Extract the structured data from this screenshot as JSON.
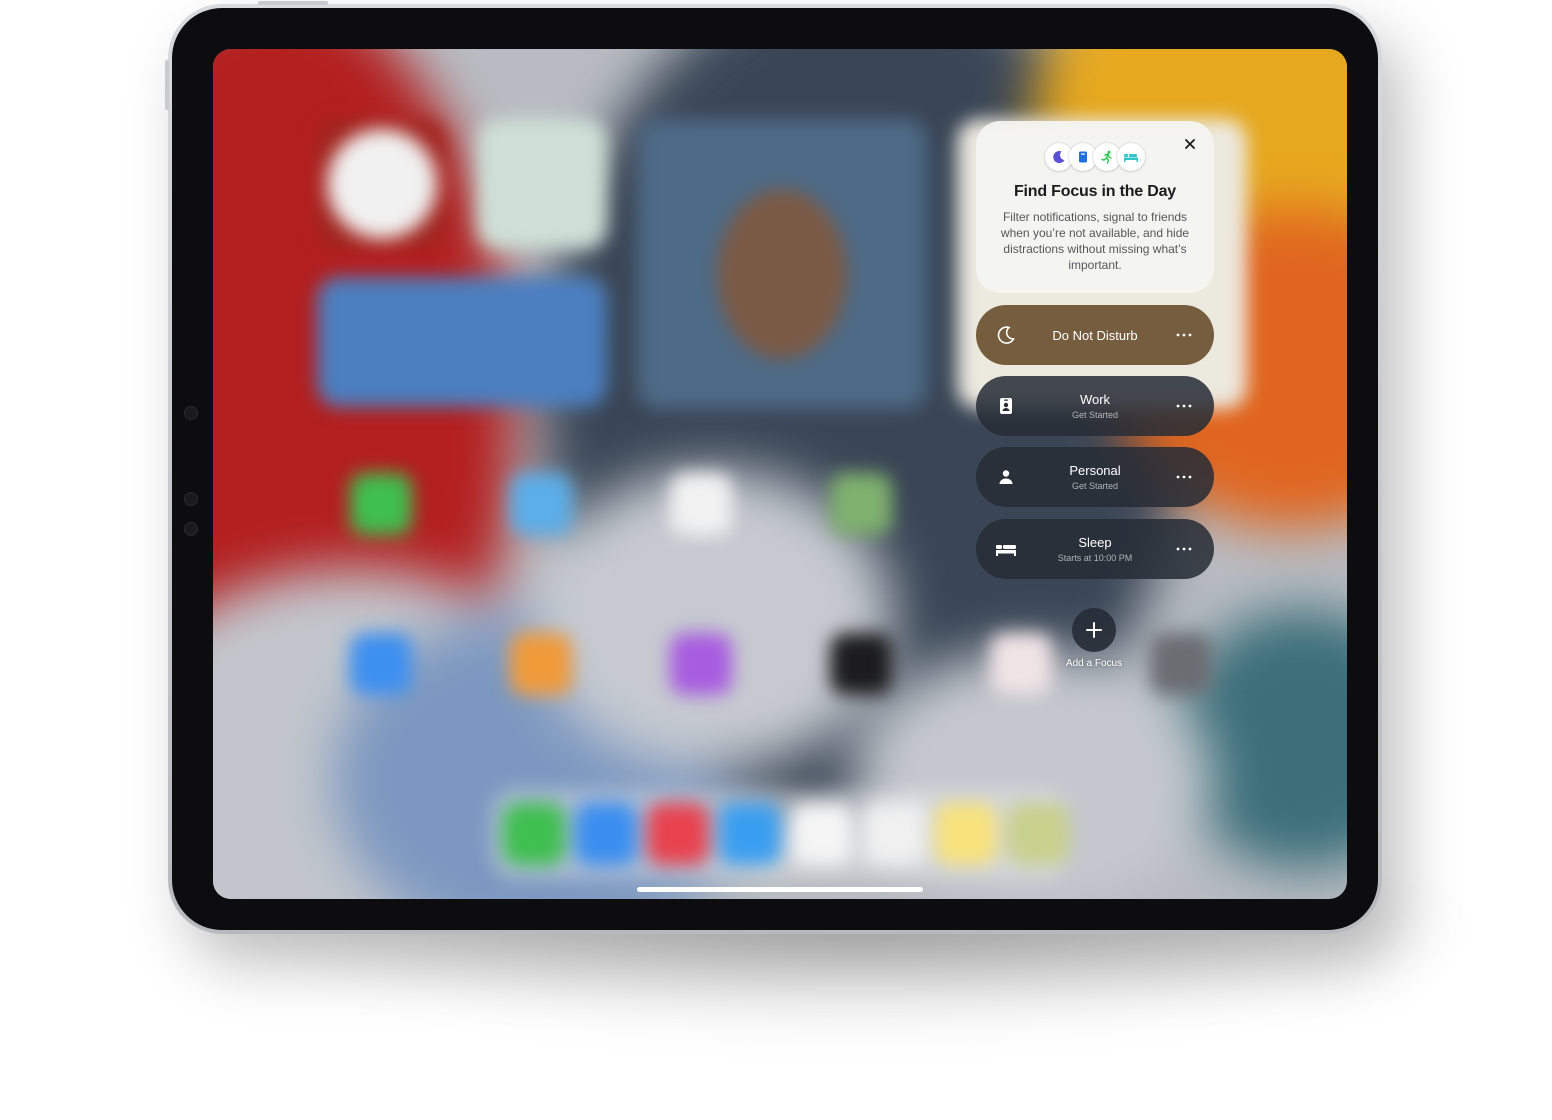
{
  "focus_intro": {
    "title": "Find Focus in the Day",
    "description": "Filter notifications, signal to friends when you’re not available, and hide distractions without missing what’s important.",
    "icons": [
      "moon-icon",
      "book-icon",
      "running-icon",
      "bed-icon"
    ],
    "close_icon": "close-icon"
  },
  "focus_modes": [
    {
      "name": "Do Not Disturb",
      "subtitle": "",
      "icon": "moon-icon",
      "active": true
    },
    {
      "name": "Work",
      "subtitle": "Get Started",
      "icon": "badge-icon",
      "active": false
    },
    {
      "name": "Personal",
      "subtitle": "Get Started",
      "icon": "person-icon",
      "active": false
    },
    {
      "name": "Sleep",
      "subtitle": "Starts at 10:00 PM",
      "icon": "bed-icon",
      "active": false
    }
  ],
  "add_focus": {
    "label": "Add a Focus",
    "icon": "plus-icon"
  },
  "colors": {
    "active_mode": "#6e5434",
    "inactive_mode": "#262c36",
    "card_background": "#f4f4f2",
    "moon_icon": "#5b4fd6",
    "book_icon": "#1f6fe0",
    "running_icon": "#34c759",
    "bed_icon": "#30c5c8"
  }
}
